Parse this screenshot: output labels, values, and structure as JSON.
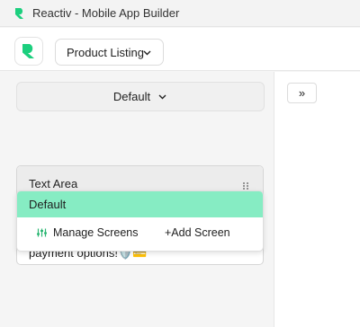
{
  "window": {
    "title": "Reactiv - Mobile App Builder",
    "logo_icon": "reactiv-logo-icon"
  },
  "toolbar": {
    "screen_selector_value": "Product Listing",
    "brand_color": "#1ccf7e"
  },
  "left_panel": {
    "variant_selector_value": "Default",
    "dropdown": {
      "options": [
        "Default"
      ],
      "selected_highlight_color": "#86ecc3",
      "manage_label": "Manage Screens",
      "add_label": "+Add Screen"
    },
    "text_area_card": {
      "title": "Text Area",
      "body": "Use this section to highlight exclusive offers, trusted badges, and showcase easy payment options!🛡️💳"
    }
  },
  "right_panel": {
    "expand_label": "»"
  }
}
